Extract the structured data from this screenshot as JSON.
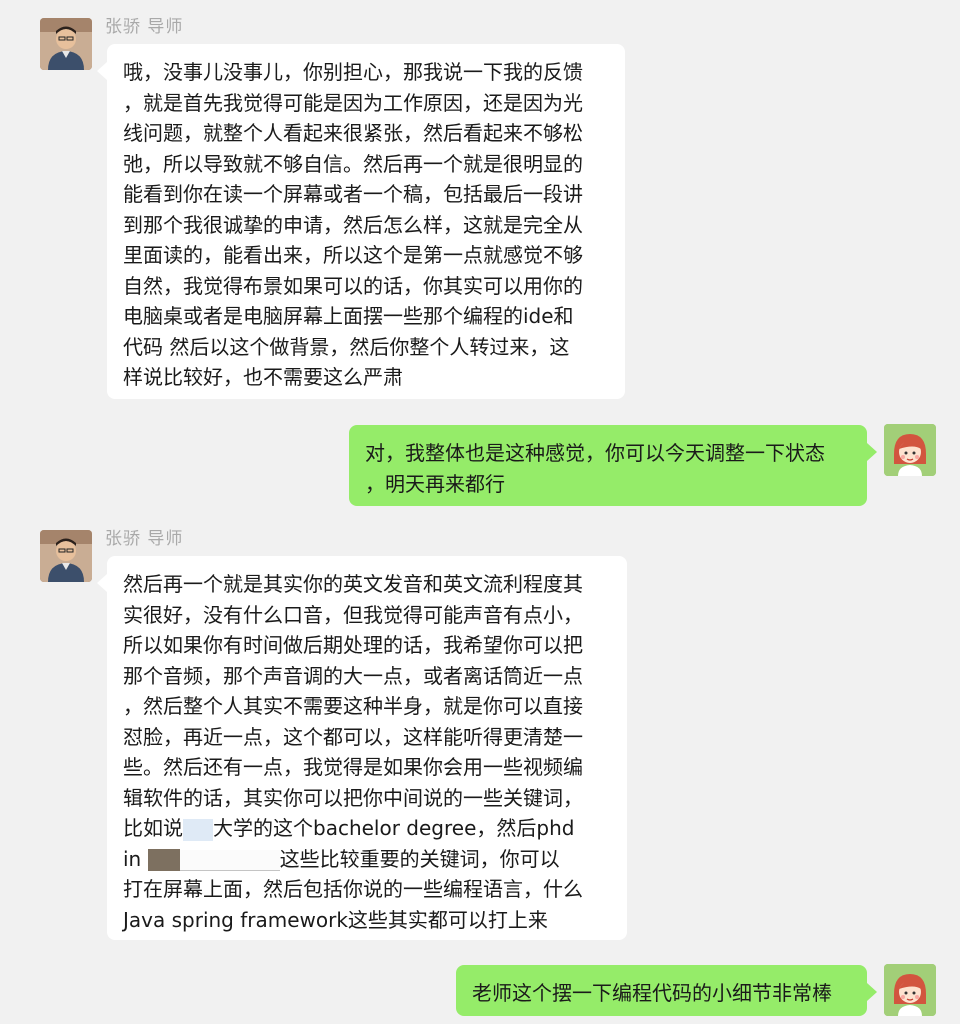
{
  "messages": [
    {
      "side": "left",
      "sender": "张骄 导师",
      "avatar_icon": "teacher-avatar-icon",
      "lines": [
        "哦，没事儿没事儿，你别担心，那我说一下我的反馈",
        "，就是首先我觉得可能是因为工作原因，还是因为光",
        "线问题，就整个人看起来很紧张，然后看起来不够松",
        "弛，所以导致就不够自信。然后再一个就是很明显的",
        "能看到你在读一个屏幕或者一个稿，包括最后一段讲",
        "到那个我很诚挚的申请，然后怎么样，这就是完全从",
        "里面读的，能看出来，所以这个是第一点就感觉不够",
        "自然，我觉得布景如果可以的话，你其实可以用你的",
        "电脑桌或者是电脑屏幕上面摆一些那个编程的ide和",
        "代码 然后以这个做背景，然后你整个人转过来，这",
        "样说比较好，也不需要这么严肃"
      ]
    },
    {
      "side": "right",
      "avatar_icon": "student-avatar-icon",
      "lines": [
        "对，我整体也是这种感觉，你可以今天调整一下状态",
        "，明天再来都行"
      ]
    },
    {
      "side": "left",
      "sender": "张骄 导师",
      "avatar_icon": "teacher-avatar-icon",
      "lines": [
        "然后再一个就是其实你的英文发音和英文流利程度其",
        "实很好，没有什么口音，但我觉得可能声音有点小，",
        "所以如果你有时间做后期处理的话，我希望你可以把",
        "那个音频，那个声音调的大一点，或者离话筒近一点",
        "，然后整个人其实不需要这种半身，就是你可以直接",
        "怼脸，再近一点，这个都可以，这样能听得更清楚一",
        "些。然后还有一点，我觉得是如果你会用一些视频编",
        "辑软件的话，其实你可以把你中间说的一些关键词，"
      ],
      "line_with_redaction_1": {
        "before": "比如说",
        "after": "大学的这个bachelor degree，然后phd"
      },
      "line_with_redaction_2": {
        "before": "in ",
        "after": "这些比较重要的关键词，你可以"
      },
      "lines_tail": [
        "打在屏幕上面，然后包括你说的一些编程语言，什么",
        "Java spring framework这些其实都可以打上来"
      ]
    },
    {
      "side": "right",
      "avatar_icon": "student-avatar-icon",
      "lines": [
        "老师这个摆一下编程代码的小细节非常棒"
      ]
    }
  ]
}
